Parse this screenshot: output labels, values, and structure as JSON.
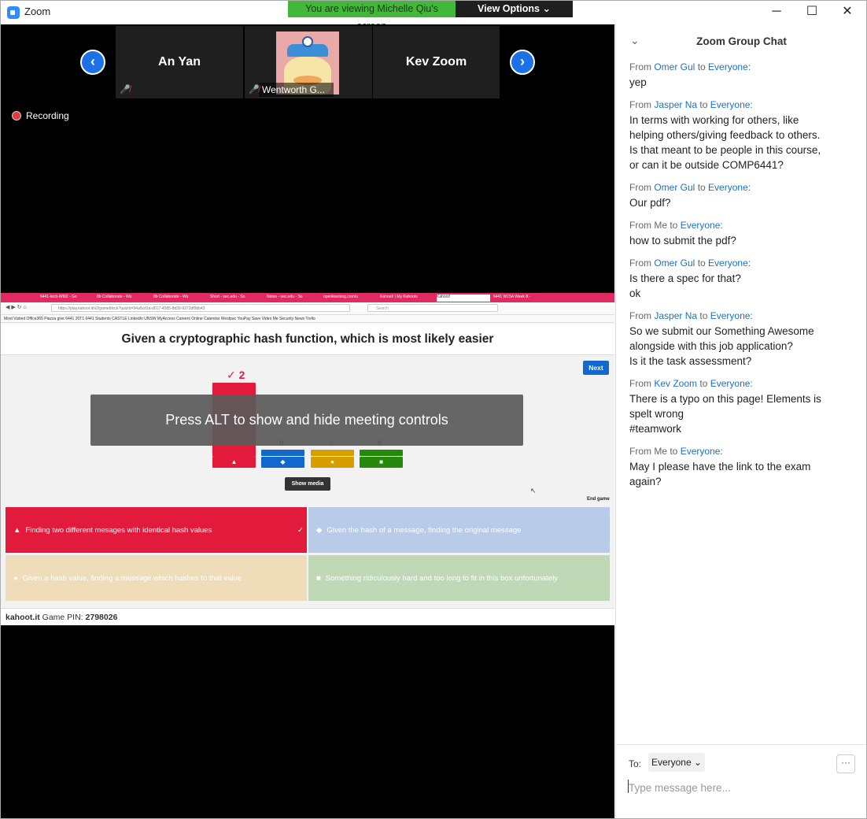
{
  "app": {
    "title": "Zoom"
  },
  "banner": {
    "viewing_text": "You are viewing Michelle Qiu's screen",
    "view_options": "View Options"
  },
  "window_controls": {
    "minimize": "─",
    "maximize": "☐",
    "close": "✕"
  },
  "participants": [
    {
      "name": "An Yan",
      "muted": true
    },
    {
      "name": "Wentworth G...",
      "muted": true,
      "has_video": true
    },
    {
      "name": "Kev Zoom",
      "muted": false
    }
  ],
  "recording": {
    "label": "Recording"
  },
  "overlay": {
    "text": "Press ALT to show and hide meeting controls"
  },
  "browser": {
    "tabs": [
      "6441-tech-W6t2 - Go",
      "8b Collaborate - Wu",
      "8b Collaborate - Wu",
      "Short - sec.edu - So",
      "Notes - sec.edu - So",
      "openlearning.com/u",
      "Kahoot! | My Kahoots",
      "Kahoot!",
      "6441 W15A Week 8 -"
    ],
    "url": "https://play.kahoot.it/v2/gameblock?quizId=94a5cd1a-d017-4585-8d39-9372df9bb43",
    "search_placeholder": "Search",
    "bookmarks": "Most Visited  Office365  Piazza  give  6441 20T1  6441 Students  CASTLE  LinkedIn  UNSW MyAccess  Careers Online  Calendar  Westpac  YouPay  Save Video Me  Security News  Trello"
  },
  "kahoot": {
    "question": "Given a cryptographic hash function, which is most likely easier",
    "next": "Next",
    "show_media": "Show media",
    "end_game": "End game",
    "results": [
      {
        "count": "2",
        "correct": true,
        "color": "#e21b3c",
        "symbol": "▲"
      },
      {
        "count": "0",
        "correct": false,
        "color": "#1368ce",
        "symbol": "◆"
      },
      {
        "count": "0",
        "correct": false,
        "color": "#d89e00",
        "symbol": "●"
      },
      {
        "count": "0",
        "correct": false,
        "color": "#26890c",
        "symbol": "■"
      }
    ],
    "answers": [
      {
        "text": "Finding two different mesages with identical hash values",
        "color": "#e21b3c",
        "symbol": "▲",
        "correct": true
      },
      {
        "text": "Given the hash of a message, finding the original message",
        "color": "#b8cbe9",
        "symbol": "◆",
        "correct": false
      },
      {
        "text": "Given a hash value, finding a message which hashes to that value",
        "color": "#efdcb8",
        "symbol": "●",
        "correct": false
      },
      {
        "text": "Something ridiculously hard and too long to fit in this box unfortunately",
        "color": "#bfd9b7",
        "symbol": "■",
        "correct": false
      }
    ],
    "footer_brand": "kahoot.it",
    "footer_pin_label": "Game PIN:",
    "footer_pin": "2798026"
  },
  "chat": {
    "title": "Zoom Group Chat",
    "messages": [
      {
        "from": "Omer Gul",
        "to": "Everyone:",
        "lines": [
          "yep"
        ]
      },
      {
        "from": "Jasper Na",
        "to": "Everyone:",
        "lines": [
          "In terms with working for others, like",
          "helping others/giving feedback to others.",
          "Is that meant to be people in this course,",
          "or can it be outside COMP6441?"
        ]
      },
      {
        "from": "Omer Gul",
        "to": "Everyone:",
        "lines": [
          "Our pdf?"
        ]
      },
      {
        "from": "Me",
        "to": "Everyone:",
        "lines": [
          "how to submit the pdf?"
        ]
      },
      {
        "from": "Omer Gul",
        "to": "Everyone:",
        "lines": [
          "Is there a spec for that?",
          "ok"
        ]
      },
      {
        "from": "Jasper Na",
        "to": "Everyone:",
        "lines": [
          "So we submit our Something Awesome",
          "alongside with this job application?",
          "Is it the task assessment?"
        ]
      },
      {
        "from": "Kev Zoom",
        "to": "Everyone:",
        "lines": [
          "There is a typo on this page! Elements is",
          "spelt wrong",
          "#teamwork"
        ]
      },
      {
        "from": "Me",
        "to": "Everyone:",
        "lines": [
          "May I please have the link to the exam",
          "again?"
        ]
      }
    ],
    "to_label": "To:",
    "recipient": "Everyone",
    "more": "···",
    "input_placeholder": "Type message here..."
  }
}
